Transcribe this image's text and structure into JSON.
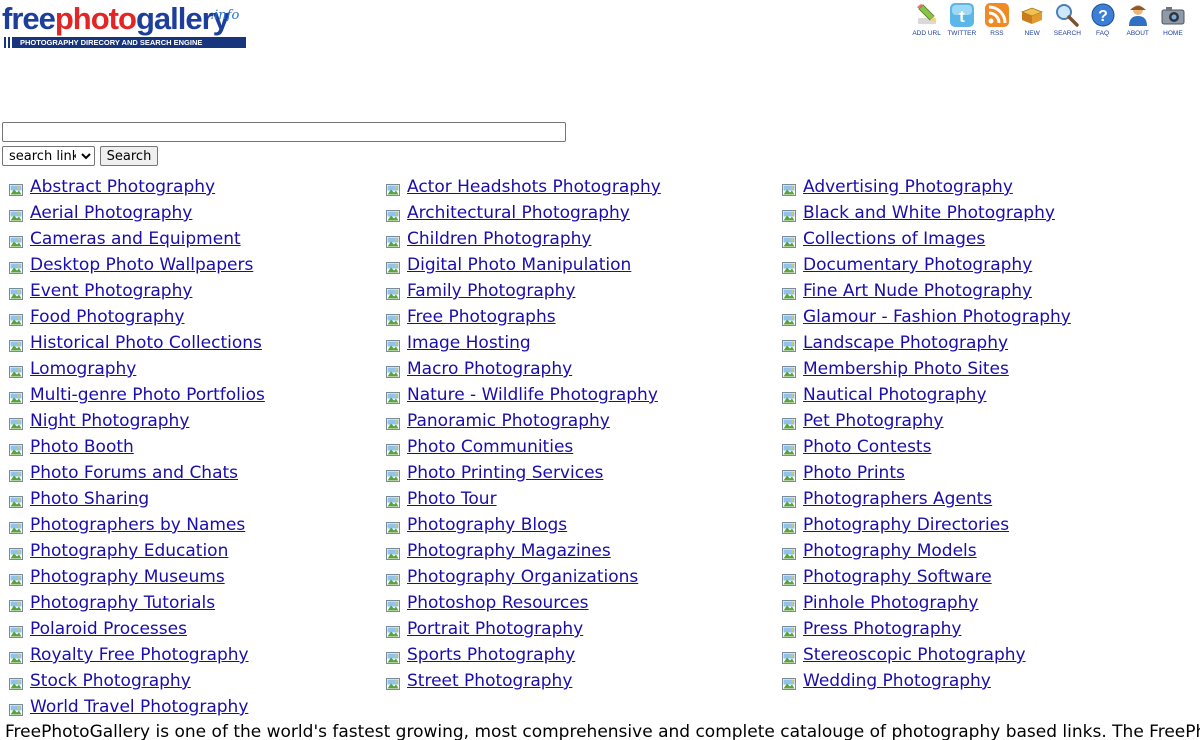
{
  "logo": {
    "part1": "free",
    "part2": "photo",
    "part3": "gallery",
    "suffix": ".info",
    "tagline": "PHOTOGRAPHY DIRECORY AND SEARCH ENGINE"
  },
  "topnav": [
    {
      "label": "ADD URL",
      "icon": "pencil-icon"
    },
    {
      "label": "TWITTER",
      "icon": "twitter-icon"
    },
    {
      "label": "RSS",
      "icon": "rss-icon"
    },
    {
      "label": "NEW",
      "icon": "book-icon"
    },
    {
      "label": "SEARCH",
      "icon": "magnifier-icon"
    },
    {
      "label": "FAQ",
      "icon": "help-icon"
    },
    {
      "label": "ABOUT",
      "icon": "person-icon"
    },
    {
      "label": "HOME",
      "icon": "camera-icon"
    }
  ],
  "search": {
    "value": "",
    "select_value": "search links",
    "button_label": "Search"
  },
  "categories": {
    "col1": [
      "Abstract Photography",
      "Aerial Photography",
      "Cameras and Equipment",
      "Desktop Photo Wallpapers",
      "Event Photography",
      "Food Photography",
      "Historical Photo Collections",
      "Lomography",
      "Multi-genre Photo Portfolios",
      "Night Photography",
      "Photo Booth",
      "Photo Forums and Chats",
      "Photo Sharing",
      "Photographers by Names",
      "Photography Education",
      "Photography Museums",
      "Photography Tutorials",
      "Polaroid Processes",
      "Royalty Free Photography",
      "Stock Photography",
      "World Travel Photography"
    ],
    "col2": [
      "Actor Headshots Photography",
      "Architectural Photography",
      "Children Photography",
      "Digital Photo Manipulation",
      "Family Photography",
      "Free Photographs",
      "Image Hosting",
      "Macro Photography",
      "Nature - Wildlife Photography",
      "Panoramic Photography",
      "Photo Communities",
      "Photo Printing Services",
      "Photo Tour",
      "Photography Blogs",
      "Photography Magazines",
      "Photography Organizations",
      "Photoshop Resources",
      "Portrait Photography",
      "Sports Photography",
      "Street Photography"
    ],
    "col3": [
      "Advertising Photography",
      "Black and White Photography",
      "Collections of Images",
      "Documentary Photography",
      "Fine Art Nude Photography",
      "Glamour - Fashion Photography",
      "Landscape Photography",
      "Membership Photo Sites",
      "Nautical Photography",
      "Pet Photography",
      "Photo Contests",
      "Photo Prints",
      "Photographers Agents",
      "Photography Directories",
      "Photography Models",
      "Photography Software",
      "Pinhole Photography",
      "Press Photography",
      "Stereoscopic Photography",
      "Wedding Photography"
    ]
  },
  "footer_text": "FreePhotoGallery is one of the world's fastest growing, most comprehensive and complete catalouge of photography based links. The FreePhotoGallery",
  "colors": {
    "link": "#1a0dab",
    "logo_blue": "#1d3f9a",
    "logo_red": "#e32525",
    "bar": "#17357d"
  }
}
